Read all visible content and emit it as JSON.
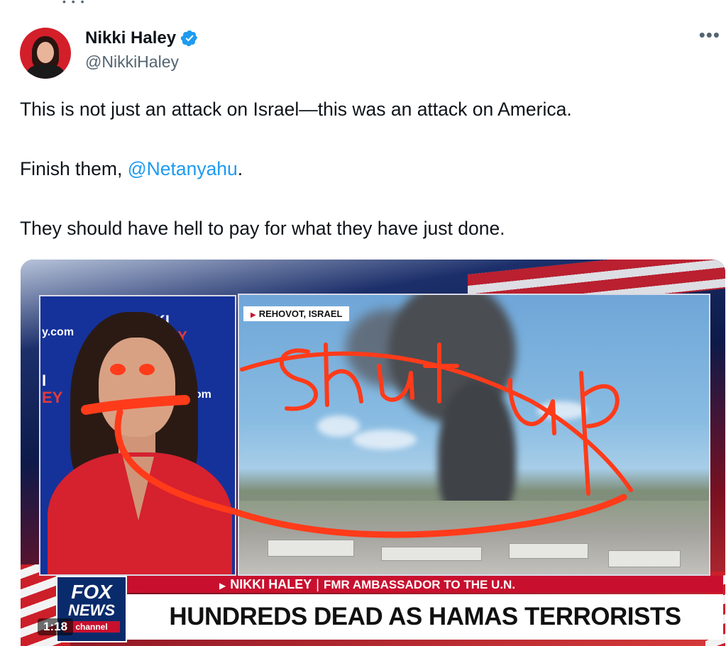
{
  "author": {
    "display_name": "Nikki Haley",
    "handle": "@NikkiHaley",
    "verified_icon": "verified-badge-icon",
    "verified_color": "#1d9bf0"
  },
  "more_icon": "ellipsis-icon",
  "tweet": {
    "line1": "This is not just an attack on Israel—this was an attack on America.",
    "line2_prefix": "Finish them, ",
    "line2_mention": "@Netanyahu",
    "line2_suffix": ".",
    "line3": "They should have hell to pay for what they have just done.",
    "mention_color": "#1d9bf0"
  },
  "media": {
    "location_tag": "REHOVOT, ISRAEL",
    "left_panel_texts": [
      "y.com",
      "KI",
      "EY",
      "I",
      "EY",
      "com"
    ],
    "scribble_text": "shut up",
    "scribble_color": "#ff3b1a",
    "lower_third": {
      "logo_line1": "FOX",
      "logo_line2": "NEWS",
      "logo_line3": "channel",
      "name": "NIKKI HALEY",
      "separator": "|",
      "role": "FMR AMBASSADOR TO THE U.N.",
      "headline": "HUNDREDS DEAD AS HAMAS TERRORISTS INVADE ISRAEL"
    },
    "timestamp": "1:18"
  }
}
